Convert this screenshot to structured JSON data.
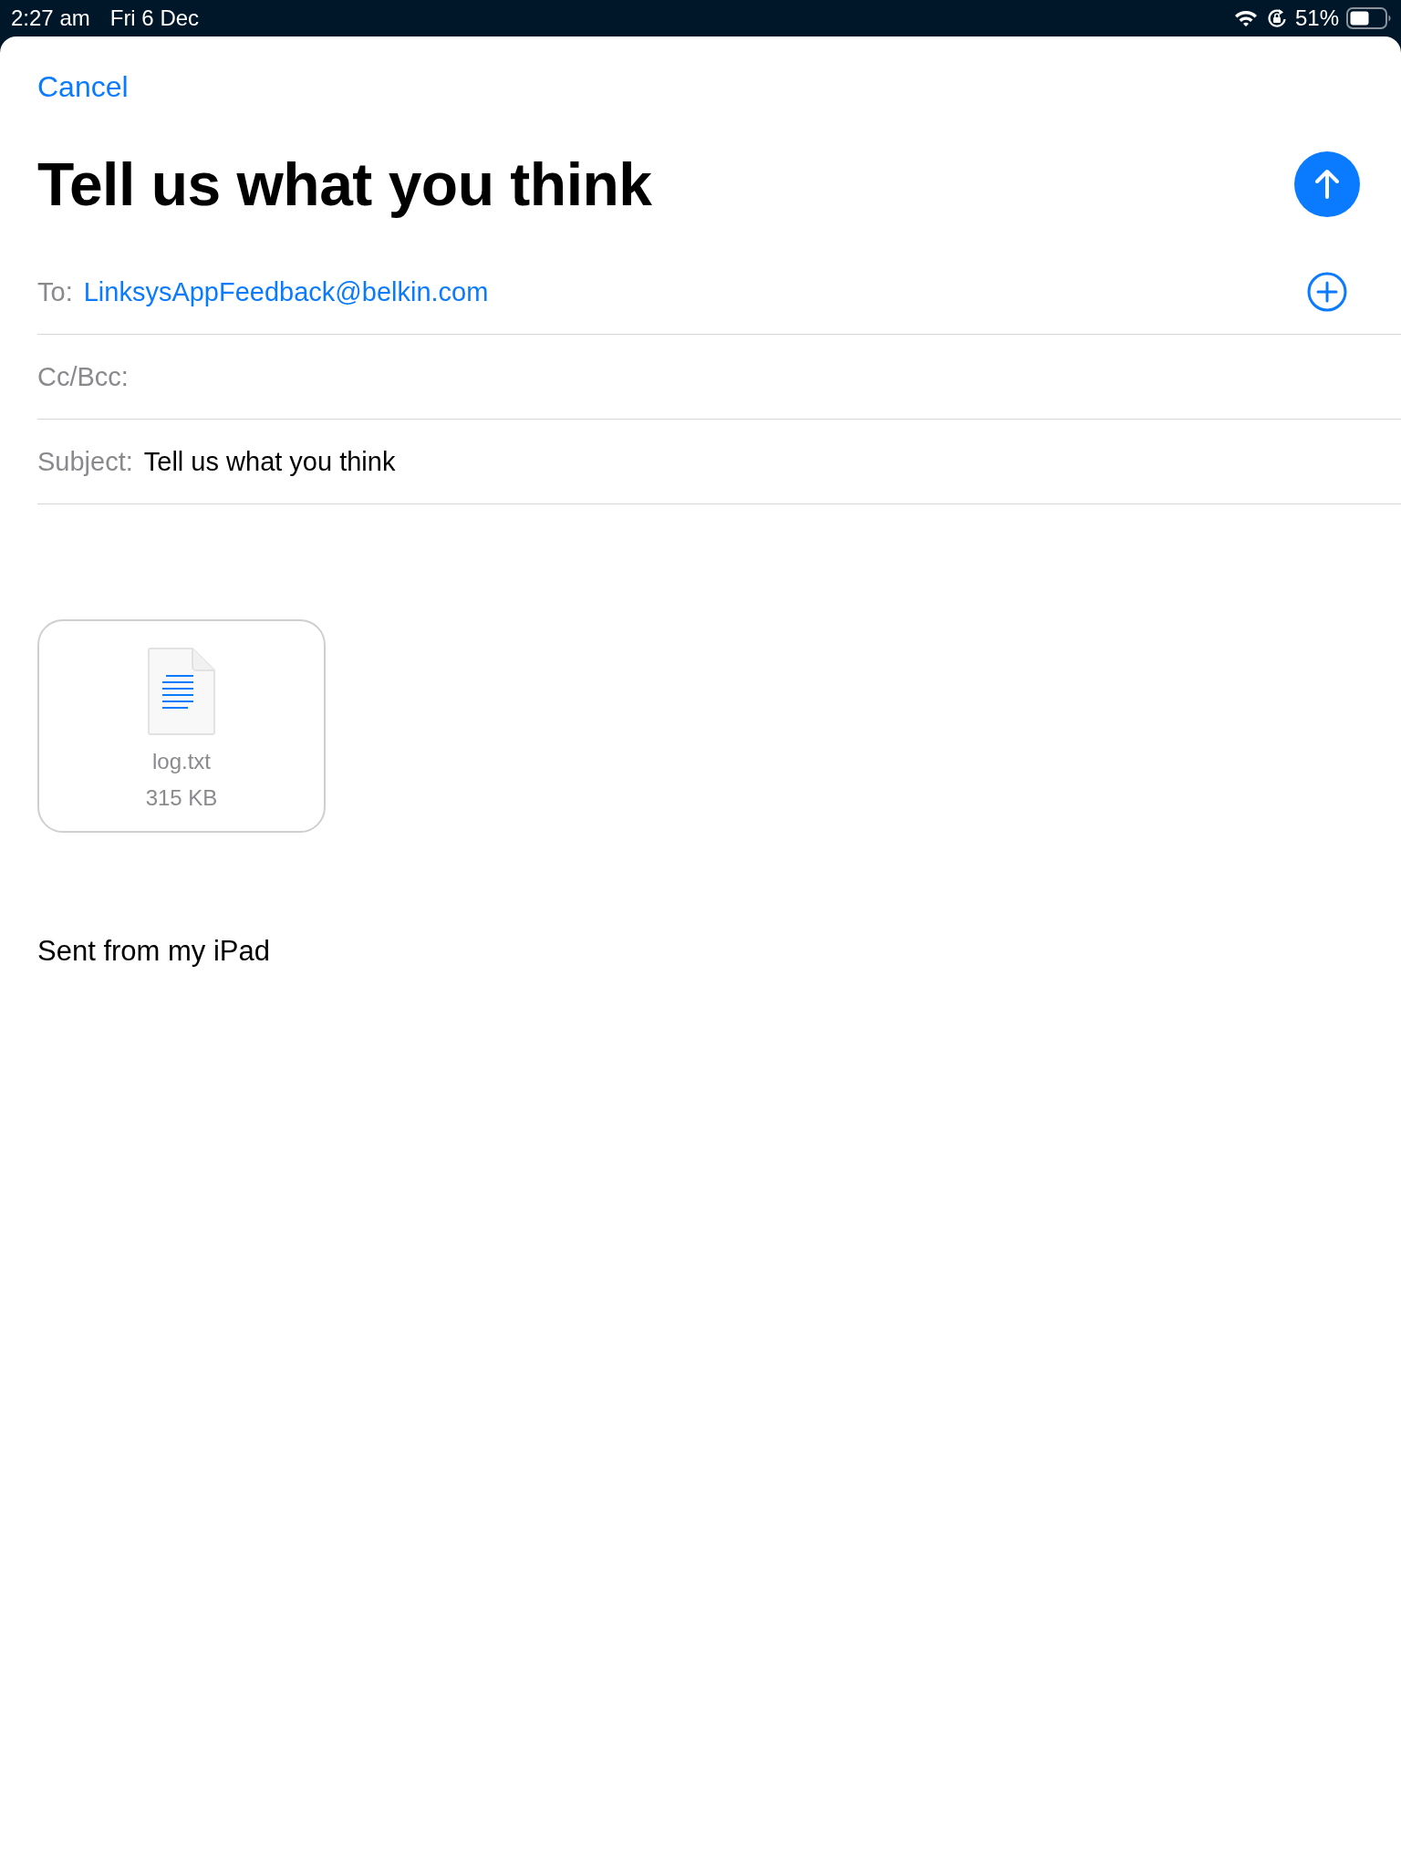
{
  "status_bar": {
    "time": "2:27 am",
    "date": "Fri 6 Dec",
    "battery": "51%"
  },
  "compose": {
    "cancel": "Cancel",
    "title": "Tell us what you think",
    "fields": [
      {
        "label": "To:",
        "value": "LinksysAppFeedback@belkin.com",
        "kind": "recipient"
      },
      {
        "label": "Cc/Bcc:",
        "kind": "empty"
      },
      {
        "label": "Subject:",
        "value": "Tell us what you think",
        "kind": "text"
      }
    ],
    "attachment": {
      "name": "log.txt",
      "size": "315 KB"
    },
    "signature": "Sent from my iPad"
  }
}
